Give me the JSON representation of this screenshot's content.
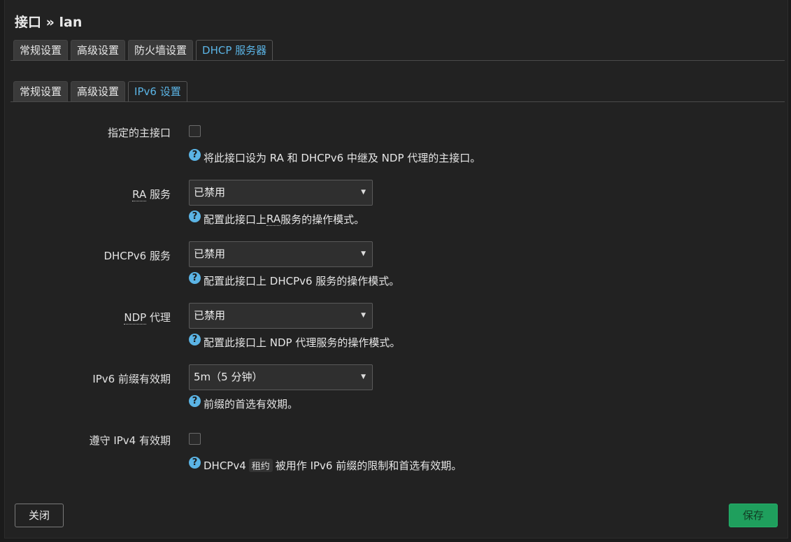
{
  "title": "接口 » lan",
  "tabs_main": [
    "常规设置",
    "高级设置",
    "防火墙设置",
    "DHCP 服务器"
  ],
  "tabs_sub": [
    "常规设置",
    "高级设置",
    "IPv6 设置"
  ],
  "fields": {
    "master": {
      "label": "指定的主接口",
      "help": "将此接口设为 RA 和 DHCPv6 中继及 NDP 代理的主接口。"
    },
    "ra": {
      "label_abbr": "RA",
      "label_rest": " 服务",
      "value": "已禁用",
      "help_pre": "配置此接口上 ",
      "help_abbr": "RA",
      "help_post": " 服务的操作模式。"
    },
    "dhcpv6": {
      "label": "DHCPv6 服务",
      "value": "已禁用",
      "help": "配置此接口上 DHCPv6 服务的操作模式。"
    },
    "ndp": {
      "label_abbr": "NDP",
      "label_rest": " 代理",
      "value": "已禁用",
      "help": "配置此接口上 NDP 代理服务的操作模式。"
    },
    "prefix_lifetime": {
      "label": "IPv6 前缀有效期",
      "value": "5m（5 分钟）",
      "help": "前缀的首选有效期。"
    },
    "ipv4_lifetime": {
      "label": "遵守 IPv4 有效期",
      "help_pre": "DHCPv4",
      "help_code": "租约",
      "help_post": "被用作 IPv6 前缀的限制和首选有效期。"
    }
  },
  "buttons": {
    "close": "关闭",
    "save": "保存"
  },
  "colors": {
    "accent": "#5bb4e5",
    "save": "#1f9f5d"
  }
}
